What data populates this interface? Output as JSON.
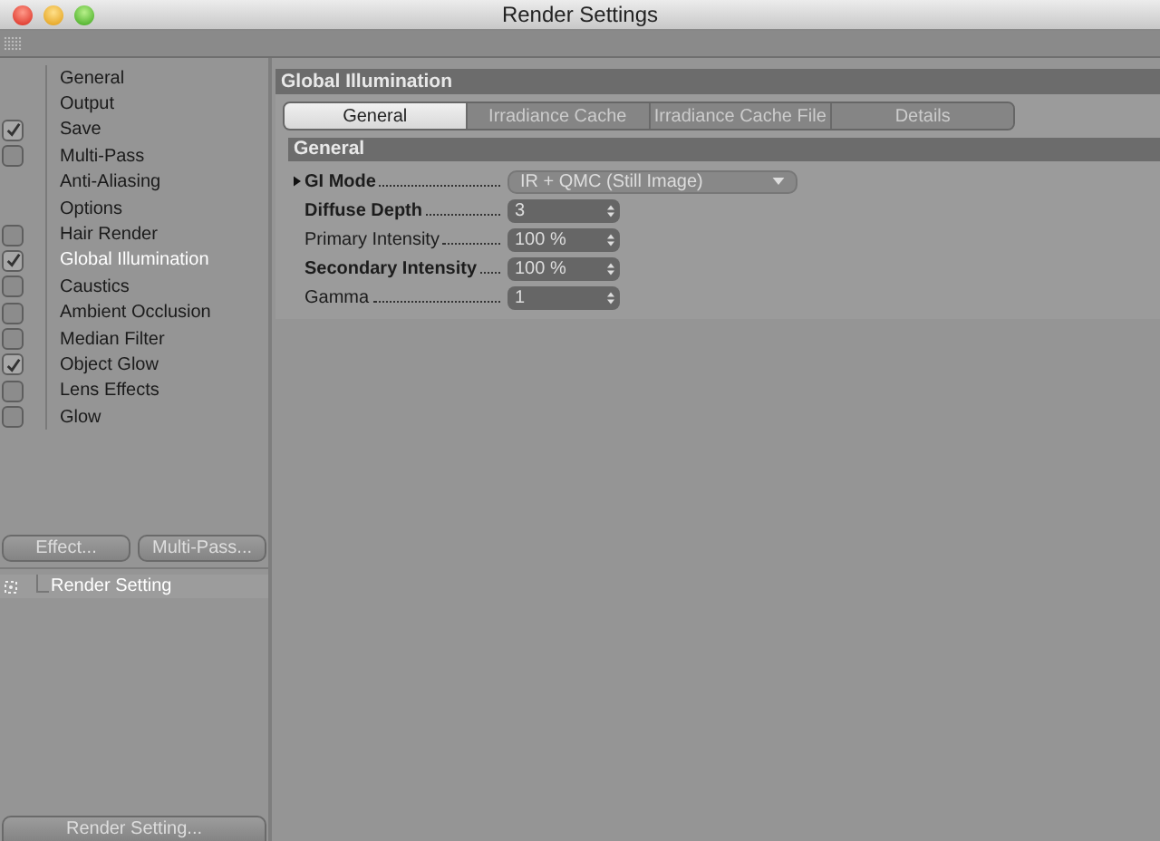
{
  "window": {
    "title": "Render Settings"
  },
  "sidebar": {
    "items": [
      {
        "label": "General",
        "kind": "plain",
        "selected": false
      },
      {
        "label": "Output",
        "kind": "plain",
        "selected": false
      },
      {
        "label": "Save",
        "kind": "check",
        "checked": true,
        "selected": false
      },
      {
        "label": "Multi-Pass",
        "kind": "check",
        "checked": false,
        "selected": false
      },
      {
        "label": "Anti-Aliasing",
        "kind": "plain",
        "selected": false
      },
      {
        "label": "Options",
        "kind": "plain",
        "selected": false
      },
      {
        "label": "Hair Render",
        "kind": "check",
        "checked": false,
        "selected": false
      },
      {
        "label": "Global Illumination",
        "kind": "check",
        "checked": true,
        "selected": true
      },
      {
        "label": "Caustics",
        "kind": "check",
        "checked": false,
        "selected": false
      },
      {
        "label": "Ambient Occlusion",
        "kind": "check",
        "checked": false,
        "selected": false
      },
      {
        "label": "Median Filter",
        "kind": "check",
        "checked": false,
        "selected": false
      },
      {
        "label": "Object Glow",
        "kind": "check",
        "checked": true,
        "selected": false
      },
      {
        "label": "Lens Effects",
        "kind": "check",
        "checked": false,
        "selected": false
      },
      {
        "label": "Glow",
        "kind": "check",
        "checked": false,
        "selected": false
      }
    ],
    "buttons": [
      "Effect...",
      "Multi-Pass..."
    ],
    "tree": [
      {
        "label": "Render Setting"
      }
    ],
    "bottom_button": "Render Setting..."
  },
  "panel": {
    "title": "Global Illumination",
    "tabs": [
      {
        "label": "General",
        "selected": true
      },
      {
        "label": "Irradiance Cache",
        "selected": false
      },
      {
        "label": "Irradiance Cache File",
        "selected": false
      },
      {
        "label": "Details",
        "selected": false
      }
    ],
    "section": "General",
    "fields": [
      {
        "label": "GI Mode",
        "bold": true,
        "kind": "dropdown",
        "value": "IR + QMC (Still Image)",
        "expandable": true
      },
      {
        "label": "Diffuse Depth",
        "bold": true,
        "kind": "spinner",
        "value": "3"
      },
      {
        "label": "Primary Intensity",
        "bold": false,
        "kind": "spinner",
        "value": "100 %"
      },
      {
        "label": "Secondary Intensity",
        "bold": true,
        "kind": "spinner",
        "value": "100 %"
      },
      {
        "label": "Gamma",
        "bold": false,
        "kind": "spinner",
        "value": "1"
      }
    ]
  }
}
